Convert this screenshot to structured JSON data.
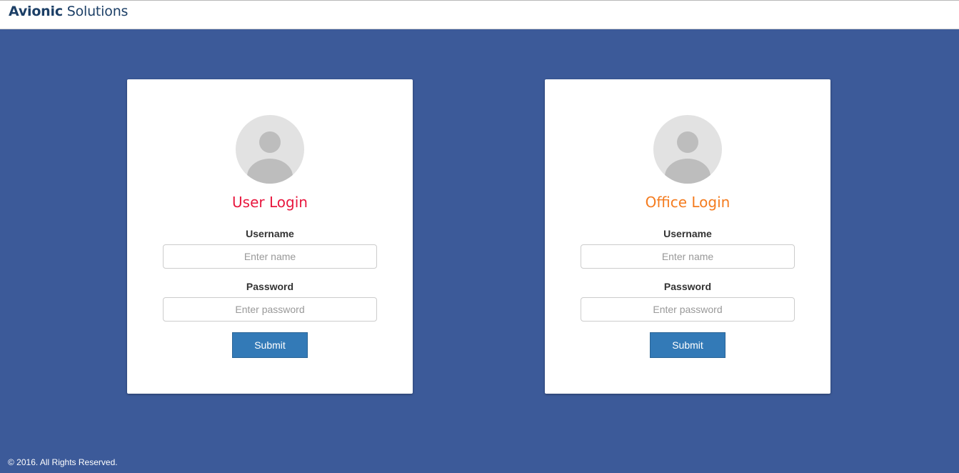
{
  "header": {
    "brand_bold": "Avionic",
    "brand_light": " Solutions"
  },
  "user_login": {
    "title": "User Login",
    "username_label": "Username",
    "username_placeholder": "Enter name",
    "password_label": "Password",
    "password_placeholder": "Enter password",
    "submit_label": "Submit",
    "title_color": "#e8183f"
  },
  "office_login": {
    "title": "Office Login",
    "username_label": "Username",
    "username_placeholder": "Enter name",
    "password_label": "Password",
    "password_placeholder": "Enter password",
    "submit_label": "Submit",
    "title_color": "#f47c20"
  },
  "footer": {
    "text": "© 2016. All Rights Reserved."
  },
  "colors": {
    "background": "#3c5a99",
    "button": "#337ab7",
    "brand": "#1c3f66"
  }
}
